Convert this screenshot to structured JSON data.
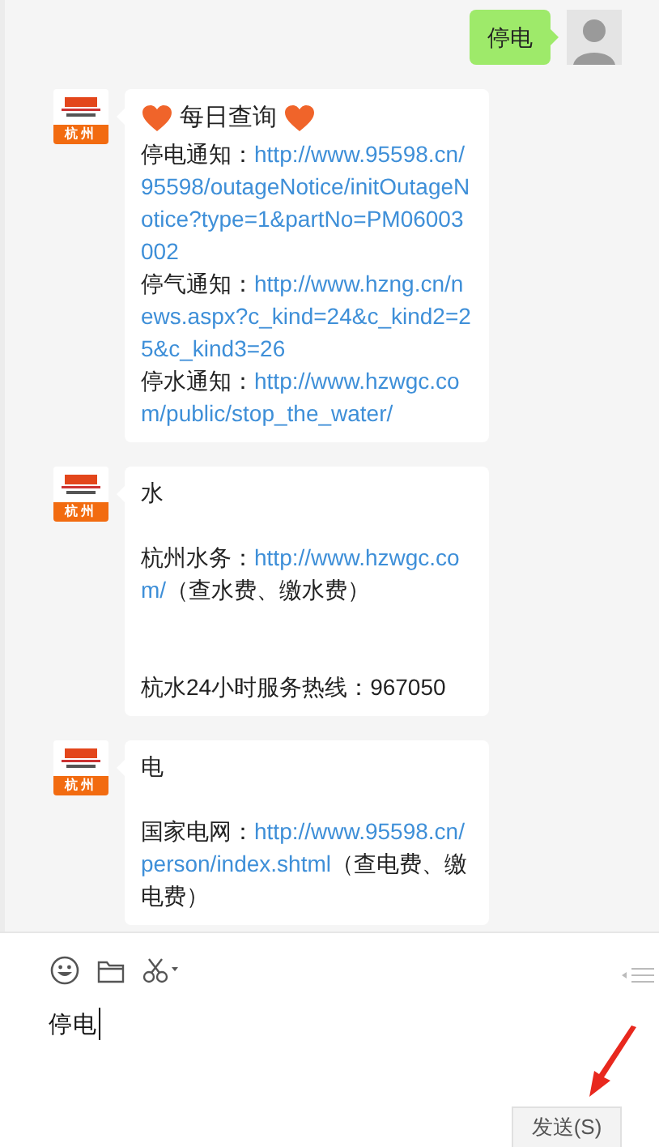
{
  "messages": [
    {
      "kind": "sent",
      "text": "停电"
    },
    {
      "kind": "received",
      "avatar_label": "杭州",
      "paragraphs": [
        {
          "kind": "title",
          "parts": [
            {
              "kind": "text",
              "text": "每日查询"
            }
          ]
        },
        {
          "kind": "line",
          "parts": [
            {
              "kind": "text",
              "text": "停电通知："
            },
            {
              "kind": "link",
              "text": "http://www.95598.cn/95598/outageNotice/initOutageNotice?type=1&partNo=PM06003002"
            }
          ]
        },
        {
          "kind": "line",
          "parts": [
            {
              "kind": "text",
              "text": "停气通知："
            },
            {
              "kind": "link",
              "text": "http://www.hzng.cn/news.aspx?c_kind=24&c_kind2=25&c_kind3=26"
            }
          ]
        },
        {
          "kind": "line",
          "parts": [
            {
              "kind": "text",
              "text": "停水通知："
            },
            {
              "kind": "link",
              "text": "http://www.hzwgc.com/public/stop_the_water/"
            }
          ]
        }
      ]
    },
    {
      "kind": "received",
      "avatar_label": "杭州",
      "paragraphs": [
        {
          "kind": "line",
          "parts": [
            {
              "kind": "text",
              "text": "水"
            }
          ]
        },
        {
          "kind": "after_blank",
          "parts": [
            {
              "kind": "text",
              "text": "杭州水务："
            },
            {
              "kind": "link",
              "text": "http://www.hzwgc.com/"
            },
            {
              "kind": "text",
              "text": "（查水费、缴水费）"
            }
          ]
        },
        {
          "kind": "after_two_blanks",
          "parts": [
            {
              "kind": "text",
              "text": "杭水24小时服务热线：967050"
            }
          ]
        }
      ]
    },
    {
      "kind": "received",
      "avatar_label": "杭州",
      "paragraphs": [
        {
          "kind": "line",
          "parts": [
            {
              "kind": "text",
              "text": "电"
            }
          ]
        },
        {
          "kind": "after_blank",
          "parts": [
            {
              "kind": "text",
              "text": "国家电网："
            },
            {
              "kind": "link",
              "text": "http://www.95598.cn/person/index.shtml"
            },
            {
              "kind": "text",
              "text": "（查电费、缴电费）"
            }
          ]
        }
      ]
    }
  ],
  "composer": {
    "value": "停电",
    "send_button": "发送(S)"
  }
}
